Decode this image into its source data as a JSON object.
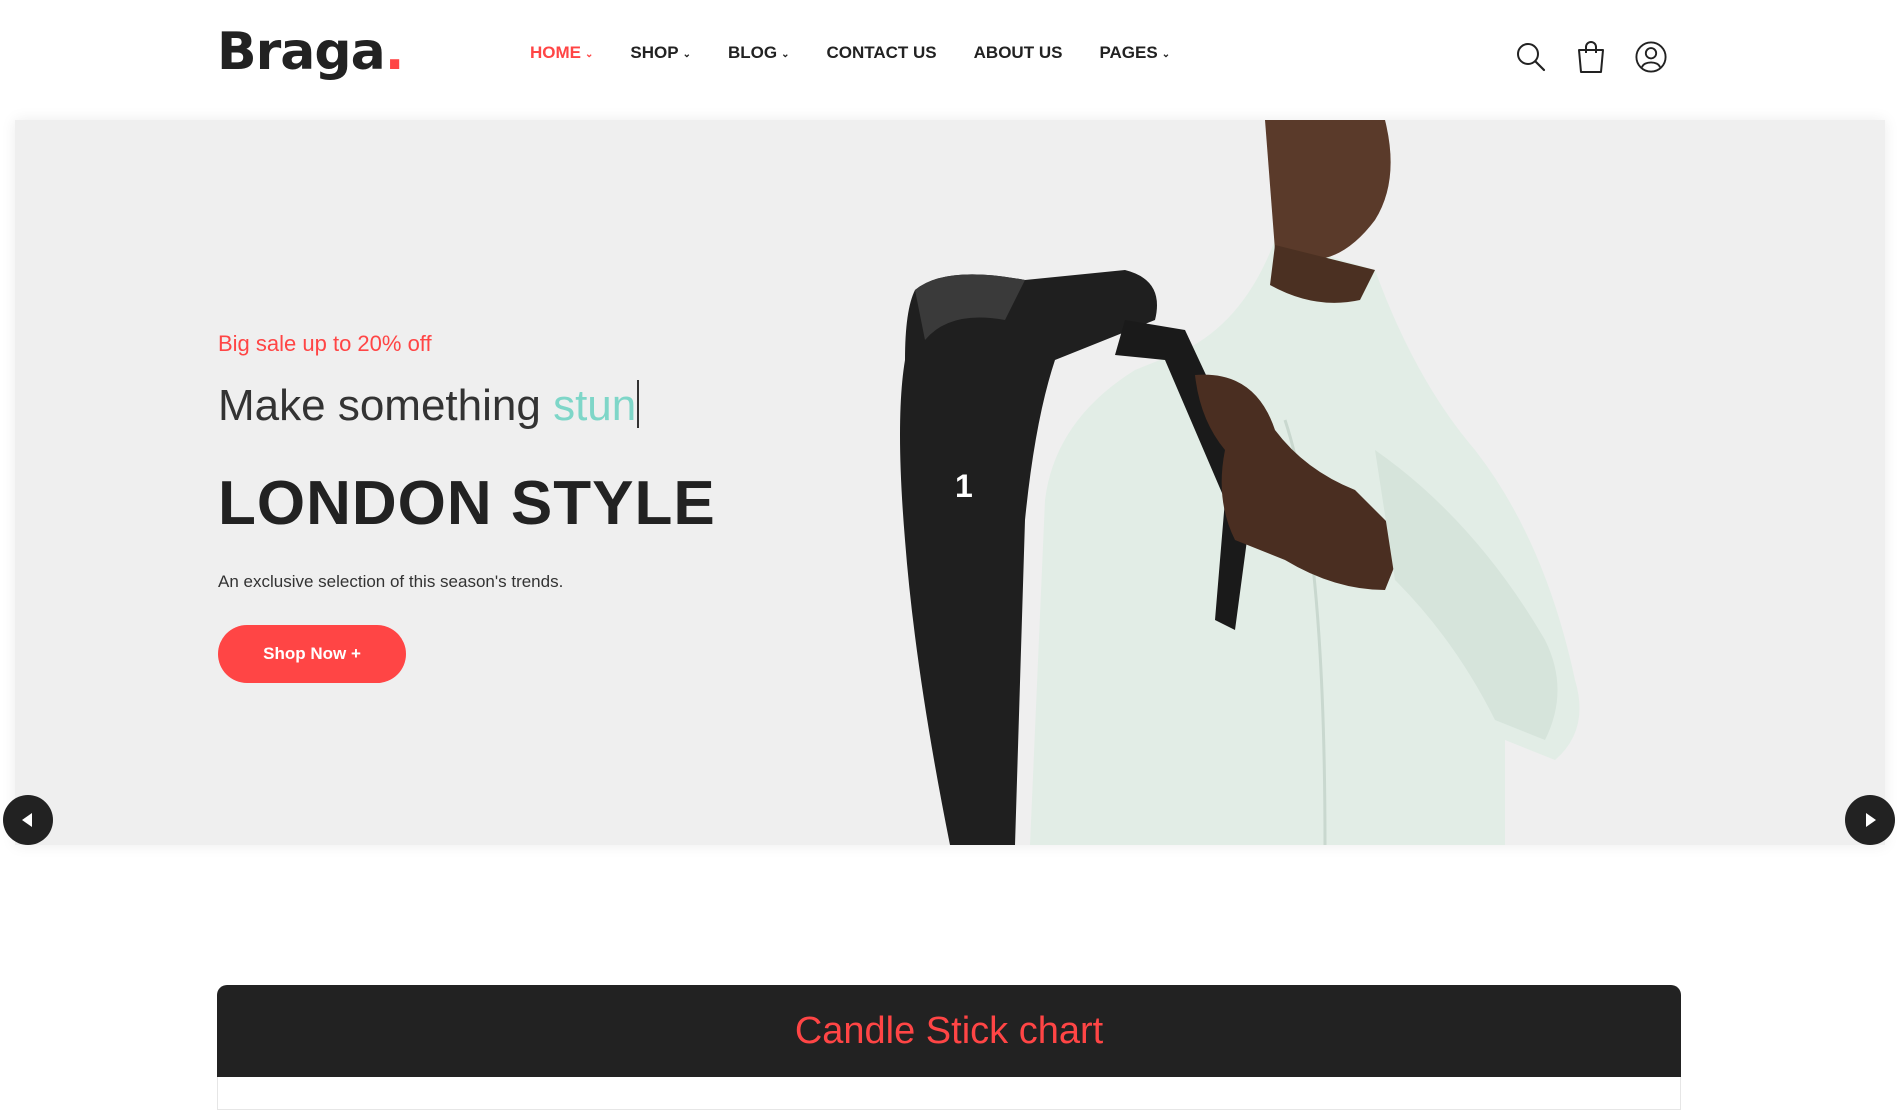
{
  "header": {
    "logo": {
      "text": "Braga",
      "dot": "."
    },
    "nav": [
      {
        "label": "HOME",
        "dropdown": true,
        "active": true
      },
      {
        "label": "SHOP",
        "dropdown": true
      },
      {
        "label": "BLOG",
        "dropdown": true
      },
      {
        "label": "CONTACT US",
        "dropdown": false
      },
      {
        "label": "ABOUT US",
        "dropdown": false
      },
      {
        "label": "PAGES",
        "dropdown": true
      }
    ],
    "icons": [
      "search-icon",
      "shopping-bag-icon",
      "user-icon"
    ]
  },
  "hero": {
    "promo": "Big sale up to 20% off",
    "typed_prefix": "Make something ",
    "typed_word": "stun",
    "headline": "LONDON STYLE",
    "subtext": "An exclusive selection of this season's trends.",
    "button_label": "Shop Now +",
    "slide_number": "1",
    "image": "man-with-black-backpack"
  },
  "chart_section": {
    "title": "Candle Stick chart"
  },
  "colors": {
    "accent": "#ff4545",
    "typed_word": "#7ed6c8",
    "dark": "#222222",
    "hero_bg": "#efefef"
  }
}
